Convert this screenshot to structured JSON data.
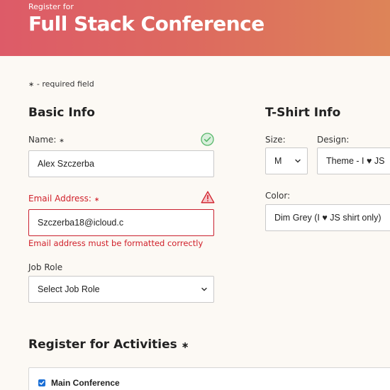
{
  "header": {
    "subtitle": "Register for",
    "title": "Full Stack Conference"
  },
  "required_note": "- required field",
  "basic_info": {
    "title": "Basic Info",
    "name": {
      "label": "Name:",
      "value": "Alex Szczerba"
    },
    "email": {
      "label": "Email Address:",
      "value": "Szczerba18@icloud.c",
      "error": "Email address must be formatted correctly"
    },
    "job_role": {
      "label": "Job Role",
      "selected": "Select Job Role"
    }
  },
  "tshirt_info": {
    "title": "T-Shirt Info",
    "size": {
      "label": "Size:",
      "selected": "M"
    },
    "design": {
      "label": "Design:",
      "selected": "Theme - I ♥ JS"
    },
    "color": {
      "label": "Color:",
      "selected": "Dim Grey (I ♥ JS shirt only)"
    }
  },
  "activities": {
    "title": "Register for Activities",
    "items": [
      {
        "label": "Main Conference",
        "checked": true
      }
    ]
  },
  "colors": {
    "header_start": "#dd5b68",
    "header_end": "#dd8458",
    "error": "#d0202a",
    "valid": "#59b86b",
    "background": "#fcf9f4"
  },
  "icons": {
    "valid": "check-circle-icon",
    "error": "warning-triangle-icon",
    "required": "asterisk-icon",
    "select": "chevron-down-icon",
    "checkbox": "checkbox-checked-icon"
  }
}
